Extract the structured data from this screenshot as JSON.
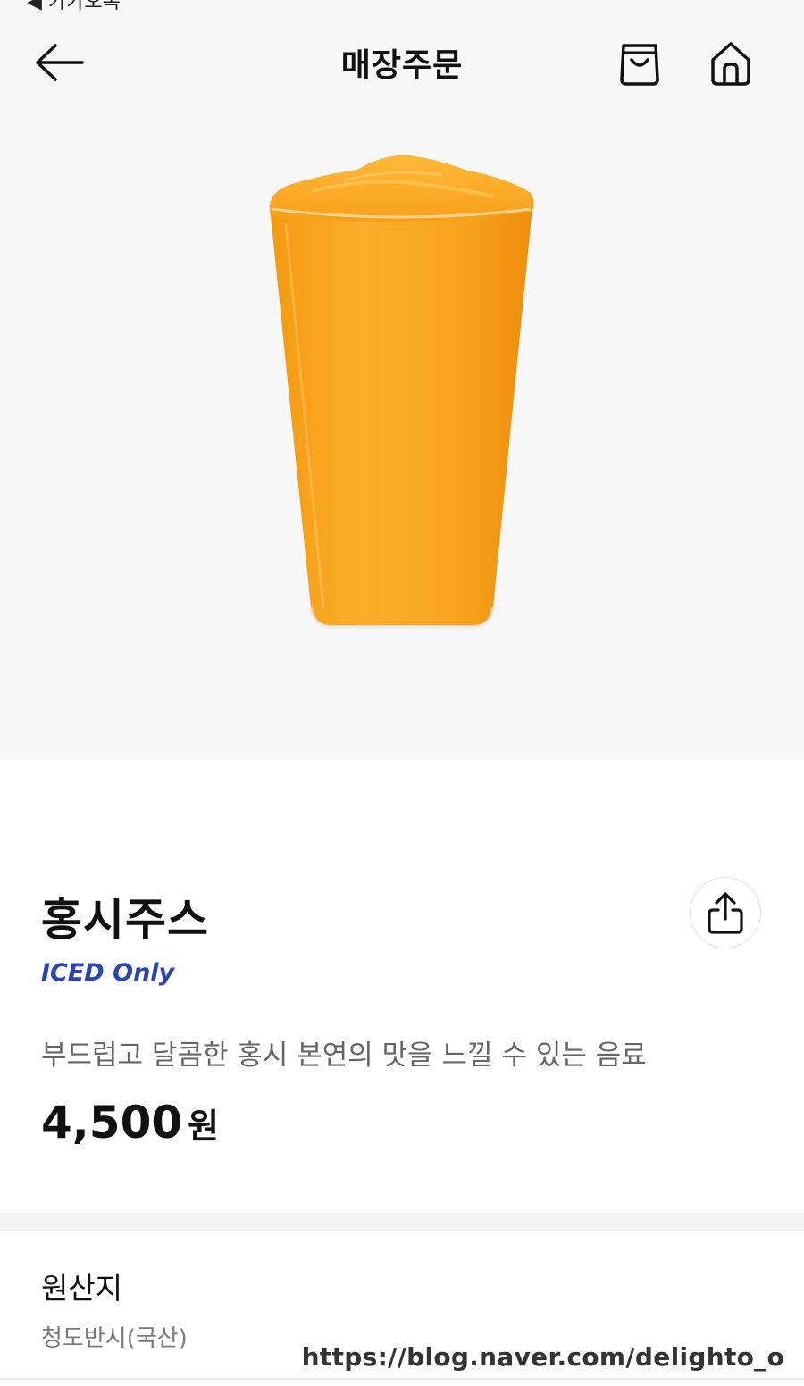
{
  "status": {
    "back_to_app": "◀ 카카오톡"
  },
  "header": {
    "title": "매장주문",
    "back_icon": "arrow-left-icon",
    "cart_icon": "shopping-bag-icon",
    "home_icon": "home-icon"
  },
  "product": {
    "name": "홍시주스",
    "temperature": "ICED Only",
    "description": "부드럽고 달콤한 홍시 본연의 맛을 느낄 수 있는 음료",
    "price": "4,500",
    "price_unit": "원",
    "share_icon": "share-icon"
  },
  "origin": {
    "title": "원산지",
    "value": "청도반시(국산)"
  },
  "watermark": "https://blog.naver.com/delighto_o",
  "colors": {
    "accent": "#2a44b2",
    "hero_bg": "#f7f7f7",
    "juice": "#f7a21b"
  }
}
